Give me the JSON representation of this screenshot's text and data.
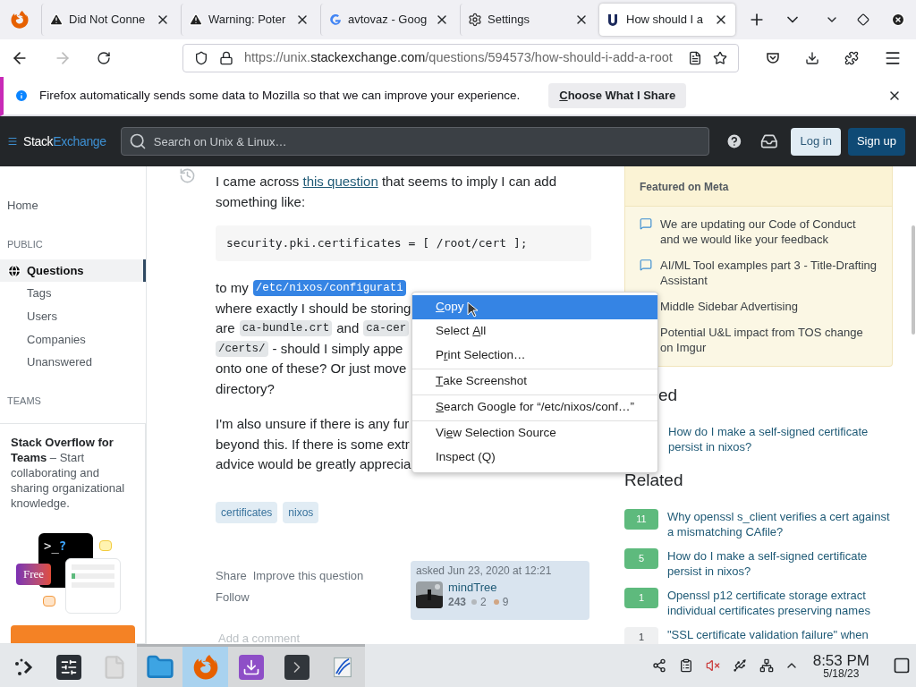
{
  "browser": {
    "tabs": [
      {
        "title": "Did Not Conne",
        "kind": "warning",
        "selected": false
      },
      {
        "title": "Warning: Poter",
        "kind": "warning",
        "selected": false
      },
      {
        "title": "avtovaz - Goog",
        "kind": "google",
        "selected": false
      },
      {
        "title": "Settings",
        "kind": "gear",
        "selected": false
      },
      {
        "title": "How should I a",
        "kind": "site",
        "selected": true
      }
    ],
    "back": {
      "disabled": false
    },
    "forward": {
      "disabled": true
    },
    "url": {
      "scheme": "https://unix.",
      "domain": "stackexchange.com",
      "path": "/questions/594573/how-should-i-add-a-root"
    },
    "notification": {
      "text": "Firefox automatically sends some data to Mozilla so that we can improve your experience.",
      "button": {
        "key": "C",
        "after": "hoose What I Share"
      }
    }
  },
  "site_header": {
    "logo": {
      "first": "Stack",
      "second": "Exchange"
    },
    "search": {
      "placeholder": "Search on Unix & Linux…"
    },
    "buttons": [
      {
        "label": "Log in",
        "kind": "secondary"
      },
      {
        "label": "Sign up",
        "kind": "primary"
      }
    ]
  },
  "left_nav": {
    "items": [
      {
        "kind": "link",
        "label": "Home",
        "selected": false
      },
      {
        "kind": "heading",
        "label": "PUBLIC"
      },
      {
        "kind": "globe_link",
        "label": "Questions",
        "selected": true
      },
      {
        "kind": "sublink",
        "label": "Tags",
        "selected": false
      },
      {
        "kind": "sublink",
        "label": "Users",
        "selected": false
      },
      {
        "kind": "sublink",
        "label": "Companies",
        "selected": false
      },
      {
        "kind": "sublink",
        "label": "Unanswered",
        "selected": false
      },
      {
        "kind": "heading",
        "label": "TEAMS"
      }
    ],
    "teams_card": {
      "text": "**Stack Overflow for Teams** – Start collaborating and sharing organizational knowledge.",
      "prompt": ">_",
      "prompt_mark": "?",
      "badge": "Free"
    }
  },
  "question": {
    "blocks": [
      {
        "kind": "linked_text",
        "before": "I came across ",
        "link": "this question",
        "after": " that seems to imply I can add something like:"
      },
      {
        "kind": "code_block",
        "text": "security.pki.certificates = [ /root/cert ];"
      },
      {
        "kind": "lines",
        "lines": [
          [
            {
              "kind": "text",
              "text": "to my"
            },
            {
              "kind": "code",
              "text": "/etc/nixos/configurati",
              "selected": true
            }
          ],
          [
            {
              "kind": "text",
              "text": "where exactly I should be storing"
            }
          ],
          [
            {
              "kind": "text",
              "text": "are"
            },
            {
              "kind": "code",
              "text": "ca-bundle.crt",
              "selected": false
            },
            {
              "kind": "text",
              "text": "and"
            },
            {
              "kind": "code",
              "text": "ca-cer",
              "selected": false
            }
          ],
          [
            {
              "kind": "code",
              "text": "/certs/",
              "selected": false
            },
            {
              "kind": "text",
              "text": "- should I simply appe"
            }
          ],
          [
            {
              "kind": "text",
              "text": "onto one of these? Or just move"
            }
          ],
          [
            {
              "kind": "text",
              "text": "directory?"
            }
          ]
        ]
      },
      {
        "kind": "lines",
        "lines": [
          [
            {
              "kind": "text",
              "text": "I'm also unsure if there is any fur"
            }
          ],
          [
            {
              "kind": "text",
              "text": "beyond this. If there is some extr"
            }
          ],
          [
            {
              "kind": "text",
              "text": "advice would be greatly apprecia"
            }
          ]
        ]
      }
    ],
    "tags": [
      "certificates",
      "nixos"
    ],
    "post_menu": [
      "Share",
      "Improve this question",
      "Follow"
    ],
    "owner": {
      "asked": "asked Jun 23, 2020 at 12:21",
      "name": "mindTree",
      "reputation": "243",
      "silver": "2",
      "bronze": "9"
    },
    "comment_link": "Add a comment"
  },
  "context_menu": {
    "items": [
      {
        "kind": "item",
        "key": "C",
        "after": "opy",
        "selected": true
      },
      {
        "kind": "item",
        "before": "Select ",
        "key": "A",
        "after": "ll",
        "selected": false
      },
      {
        "kind": "item",
        "before": "P",
        "key": "r",
        "after": "int Selection…",
        "selected": false
      },
      {
        "kind": "separator"
      },
      {
        "kind": "item",
        "key": "T",
        "after": "ake Screenshot",
        "selected": false
      },
      {
        "kind": "separator"
      },
      {
        "kind": "item",
        "key": "S",
        "after": "earch Google for “/etc/nixos/conf…”",
        "selected": false
      },
      {
        "kind": "separator"
      },
      {
        "kind": "item",
        "before": "Vi",
        "key": "e",
        "after": "w Selection Source",
        "selected": false
      },
      {
        "kind": "item",
        "before": "Inspect (Q)",
        "selected": false
      }
    ]
  },
  "sidebar": {
    "featured": {
      "title": "Featured on Meta",
      "items": [
        {
          "text": "We are updating our Code of Conduct and we would like your feedback",
          "kind": "chat"
        },
        {
          "text": "AI/ML Tool examples part 3 - Title-Drafting Assistant",
          "kind": "chat"
        },
        {
          "text": "Middle Sidebar Advertising",
          "kind": "plain"
        },
        {
          "text": "Potential U&L impact from TOS change on Imgur",
          "kind": "plain"
        }
      ]
    },
    "linked": {
      "heading": "ed",
      "items": [
        {
          "title": "How do I make a self-signed certificate persist in nixos?"
        }
      ]
    },
    "related": {
      "heading": "Related",
      "items": [
        {
          "score": "11",
          "accepted": true,
          "title": "Why openssl s_client verifies a cert against a mismatching CAfile?"
        },
        {
          "score": "5",
          "accepted": true,
          "title": "How do I make a self-signed certificate persist in nixos?"
        },
        {
          "score": "1",
          "accepted": true,
          "title": "Openssl p12 certificate storage extract individual certificates preserving names"
        },
        {
          "score": "1",
          "accepted": false,
          "title": "\"SSL certificate validation failure\" when"
        }
      ]
    }
  },
  "taskbar": {
    "apps": [
      {
        "kind": "launcher",
        "open": false,
        "selected": false
      },
      {
        "kind": "settings",
        "open": false,
        "selected": false
      },
      {
        "kind": "file",
        "open": false,
        "selected": false
      },
      {
        "kind": "folder",
        "open": true,
        "selected": false
      },
      {
        "kind": "browser",
        "open": true,
        "selected": true
      },
      {
        "kind": "installer",
        "open": true,
        "selected": false
      },
      {
        "kind": "terminal",
        "open": true,
        "selected": false
      },
      {
        "kind": "viewer",
        "open": true,
        "selected": false
      }
    ],
    "clock": {
      "time": "8:53 PM",
      "date": "5/18/23"
    }
  }
}
